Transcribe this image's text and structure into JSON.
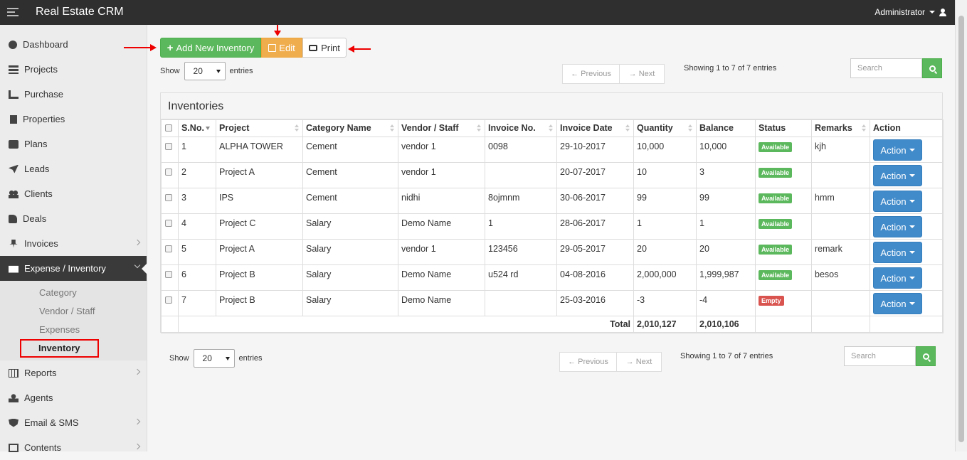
{
  "app": {
    "title": "Real Estate CRM",
    "user": "Administrator"
  },
  "sidebar": {
    "items": [
      {
        "label": "Dashboard",
        "icon": "dashboard-icon"
      },
      {
        "label": "Projects",
        "icon": "server-icon"
      },
      {
        "label": "Purchase",
        "icon": "cart-icon"
      },
      {
        "label": "Properties",
        "icon": "building-icon"
      },
      {
        "label": "Plans",
        "icon": "briefcase-icon"
      },
      {
        "label": "Leads",
        "icon": "rocket-icon"
      },
      {
        "label": "Clients",
        "icon": "users-icon"
      },
      {
        "label": "Deals",
        "icon": "thumbs-up-icon"
      },
      {
        "label": "Invoices",
        "icon": "pin-icon"
      },
      {
        "label": "Expense / Inventory",
        "icon": "money-icon"
      },
      {
        "label": "Reports",
        "icon": "table-icon"
      },
      {
        "label": "Agents",
        "icon": "agent-icon"
      },
      {
        "label": "Email & SMS",
        "icon": "shield-icon"
      },
      {
        "label": "Contents",
        "icon": "newspaper-icon"
      }
    ],
    "sub_items": [
      "Category",
      "Vendor / Staff",
      "Expenses",
      "Inventory"
    ]
  },
  "toolbar": {
    "add_label": "Add New Inventory",
    "edit_label": "Edit",
    "print_label": "Print"
  },
  "length": {
    "show": "Show",
    "value": "20",
    "entries": "entries"
  },
  "pager": {
    "prev": "← Previous",
    "next": "→ Next"
  },
  "info": "Showing 1 to 7 of 7 entries",
  "search": {
    "placeholder": "Search"
  },
  "table": {
    "title": "Inventories",
    "headers": [
      "S.No.",
      "Project",
      "Category Name",
      "Vendor / Staff",
      "Invoice No.",
      "Invoice Date",
      "Quantity",
      "Balance",
      "Status",
      "Remarks",
      "Action"
    ],
    "rows": [
      {
        "sno": "1",
        "project": "ALPHA TOWER",
        "category": "Cement",
        "vendor": "vendor 1",
        "invoice": "0098",
        "date": "29-10-2017",
        "qty": "10,000",
        "balance": "10,000",
        "status": "Available",
        "remarks": "kjh"
      },
      {
        "sno": "2",
        "project": "Project A",
        "category": "Cement",
        "vendor": "vendor 1",
        "invoice": "",
        "date": "20-07-2017",
        "qty": "10",
        "balance": "3",
        "status": "Available",
        "remarks": ""
      },
      {
        "sno": "3",
        "project": "IPS",
        "category": "Cement",
        "vendor": "nidhi",
        "invoice": "8ojmnm",
        "date": "30-06-2017",
        "qty": "99",
        "balance": "99",
        "status": "Available",
        "remarks": "hmm"
      },
      {
        "sno": "4",
        "project": "Project C",
        "category": "Salary",
        "vendor": "Demo Name",
        "invoice": "1",
        "date": "28-06-2017",
        "qty": "1",
        "balance": "1",
        "status": "Available",
        "remarks": ""
      },
      {
        "sno": "5",
        "project": "Project A",
        "category": "Salary",
        "vendor": "vendor 1",
        "invoice": "123456",
        "date": "29-05-2017",
        "qty": "20",
        "balance": "20",
        "status": "Available",
        "remarks": "remark"
      },
      {
        "sno": "6",
        "project": "Project B",
        "category": "Salary",
        "vendor": "Demo Name",
        "invoice": "u524 rd",
        "date": "04-08-2016",
        "qty": "2,000,000",
        "balance": "1,999,987",
        "status": "Available",
        "remarks": "besos"
      },
      {
        "sno": "7",
        "project": "Project B",
        "category": "Salary",
        "vendor": "Demo Name",
        "invoice": "",
        "date": "25-03-2016",
        "qty": "-3",
        "balance": "-4",
        "status": "Empty",
        "remarks": ""
      }
    ],
    "action_label": "Action",
    "total": {
      "label": "Total",
      "qty": "2,010,127",
      "balance": "2,010,106"
    }
  },
  "colors": {
    "available": "#5cb85c",
    "empty": "#d9534f",
    "action": "#428bca",
    "add": "#5cb85c",
    "edit": "#f0ad4e"
  }
}
